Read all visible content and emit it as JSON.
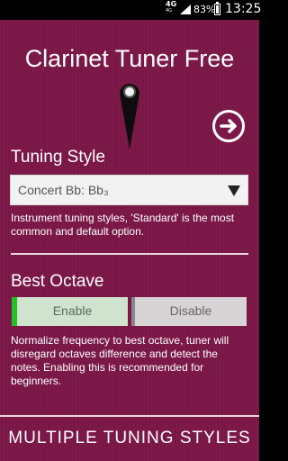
{
  "statusbar": {
    "network": "4G",
    "network_sub": "4G",
    "battery_pct": "83%",
    "time": "13:25"
  },
  "app": {
    "title": "Clarinet Tuner Free",
    "tuning_style": {
      "label": "Tuning Style",
      "selected": "Concert Bb: Bb₃",
      "description": "Instrument tuning styles, 'Standard' is the most common and default option."
    },
    "best_octave": {
      "label": "Best Octave",
      "enable_label": "Enable",
      "disable_label": "Disable",
      "selected": "Enable",
      "description": "Normalize frequency to best octave, tuner will disregard octaves difference and detect the notes. Enabling this is recommended for beginners."
    },
    "banner": "MULTIPLE TUNING STYLES"
  },
  "icons": {
    "next": "arrow-right-circle-icon",
    "needle": "tuner-needle-icon",
    "dropdown": "caret-down-icon"
  },
  "colors": {
    "background": "#7a1747",
    "enable_accent": "#22c022"
  }
}
